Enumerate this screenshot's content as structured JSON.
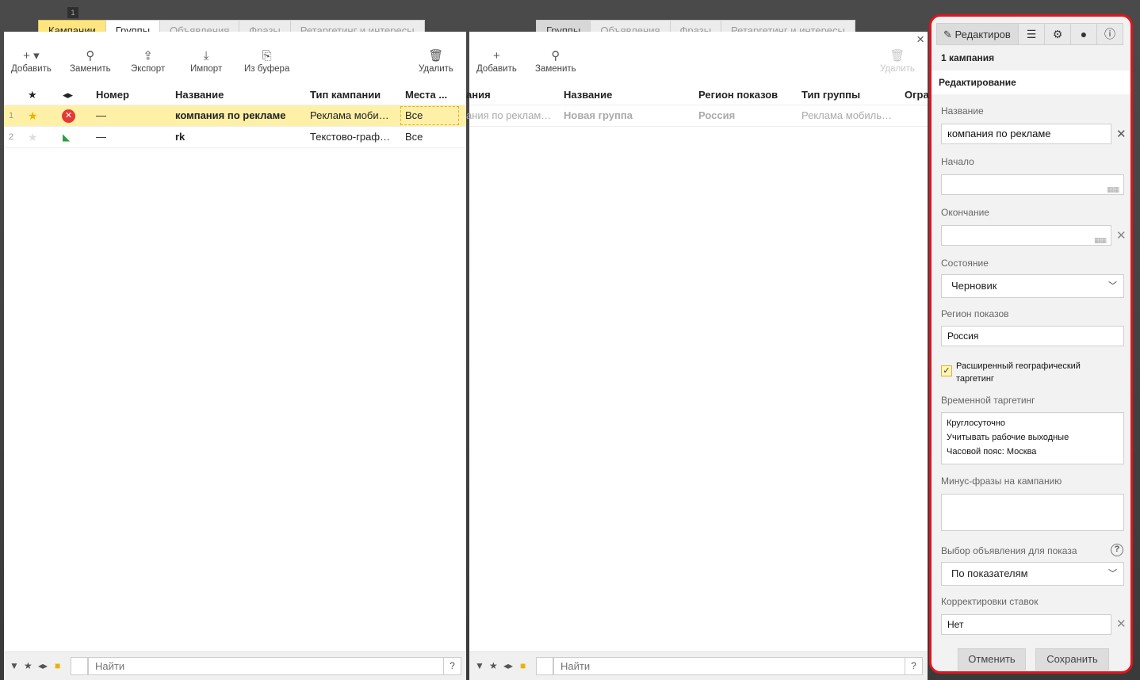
{
  "window_number": "1",
  "left": {
    "tabs": [
      "Кампании",
      "Группы",
      "Объявления",
      "Фразы",
      "Ретаргетинг и интересы"
    ],
    "toolbar": {
      "add": "Добавить",
      "replace": "Заменить",
      "export": "Экспорт",
      "import": "Импорт",
      "from_buffer": "Из буфера",
      "delete": "Удалить"
    },
    "columns": {
      "number": "Номер",
      "name": "Название",
      "type": "Тип кампании",
      "places": "Места ..."
    },
    "rows": [
      {
        "n": "1",
        "number": "—",
        "name": "компания по рекламе",
        "type": "Реклама моби…",
        "places": "Все"
      },
      {
        "n": "2",
        "number": "—",
        "name": "rk",
        "type": "Текстово-граф…",
        "places": "Все"
      }
    ],
    "find_placeholder": "Найти",
    "help": "?"
  },
  "middle": {
    "tabs": [
      "Группы",
      "Объявления",
      "Фразы",
      "Ретаргетинг и интересы"
    ],
    "toolbar": {
      "add": "Добавить",
      "replace": "Заменить",
      "delete": "Удалить"
    },
    "columns": {
      "campaign": "ания",
      "name": "Название",
      "region": "Регион показов",
      "group_type": "Тип группы",
      "limit": "Огра"
    },
    "rows": [
      {
        "campaign": "ания по реклам…",
        "name": "Новая группа",
        "region": "Россия",
        "group_type": "Реклама мобиль…"
      }
    ],
    "find_placeholder": "Найти",
    "help": "?",
    "close": "×"
  },
  "editor": {
    "tab_edit": "Редактиров",
    "count": "1 кампания",
    "section": "Редактирование",
    "name_label": "Название",
    "name_value": "компания по рекламе",
    "start_label": "Начало",
    "end_label": "Окончание",
    "state_label": "Состояние",
    "state_value": "Черновик",
    "region_label": "Регион показов",
    "region_value": "Россия",
    "geo_label": "Расширенный географический таргетинг",
    "geo_checked": true,
    "time_label": "Временной таргетинг",
    "time_lines": [
      "Круглосуточно",
      "Учитывать рабочие выходные",
      "Часовой пояс: Москва"
    ],
    "minus_label": "Минус-фразы на кампанию",
    "ad_choice_label": "Выбор объявления для показа",
    "ad_choice_value": "По показателям",
    "bids_label": "Корректировки ставок",
    "bids_value": "Нет",
    "cancel": "Отменить",
    "save": "Сохранить"
  },
  "colors": {
    "accent_yellow": "#ffe57f",
    "highlight_red": "#e0141e",
    "row_selected": "#fff0a8"
  }
}
